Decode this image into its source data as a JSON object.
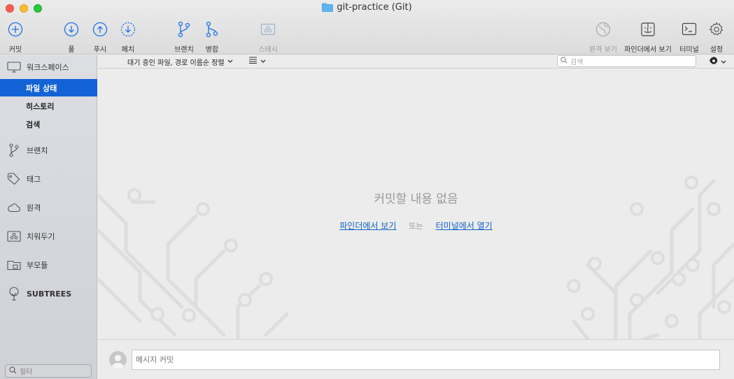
{
  "window": {
    "title": "git-practice (Git)"
  },
  "toolbar": {
    "commit": "커밋",
    "pull": "풀",
    "push": "푸시",
    "fetch": "페치",
    "branch": "브랜치",
    "merge": "병합",
    "stash": "스태시",
    "remote_view": "원격 보기",
    "finder_view": "파인더에서 보기",
    "terminal": "터미널",
    "settings": "설정"
  },
  "sidebar": {
    "workspace": "워크스페이스",
    "file_status": "파일 상태",
    "history": "히스토리",
    "search": "검색",
    "branches": "브랜치",
    "tags": "태그",
    "remotes": "원격",
    "stashes": "치워두기",
    "submodules": "부모듈",
    "subtrees": "SUBTREES",
    "filter_placeholder": "필터"
  },
  "main": {
    "sort_label": "대기 중인 파일, 경로 이름순 정렬",
    "search_placeholder": "검색",
    "empty_title": "커밋할 내용 없음",
    "link_finder": "파인더에서 보기",
    "or": "또는",
    "link_terminal": "터미널에서 열기",
    "commit_placeholder": "메시지 커밋"
  },
  "colors": {
    "accent": "#1363d6",
    "link": "#0f63c4",
    "icon_blue": "#1a73e8"
  }
}
